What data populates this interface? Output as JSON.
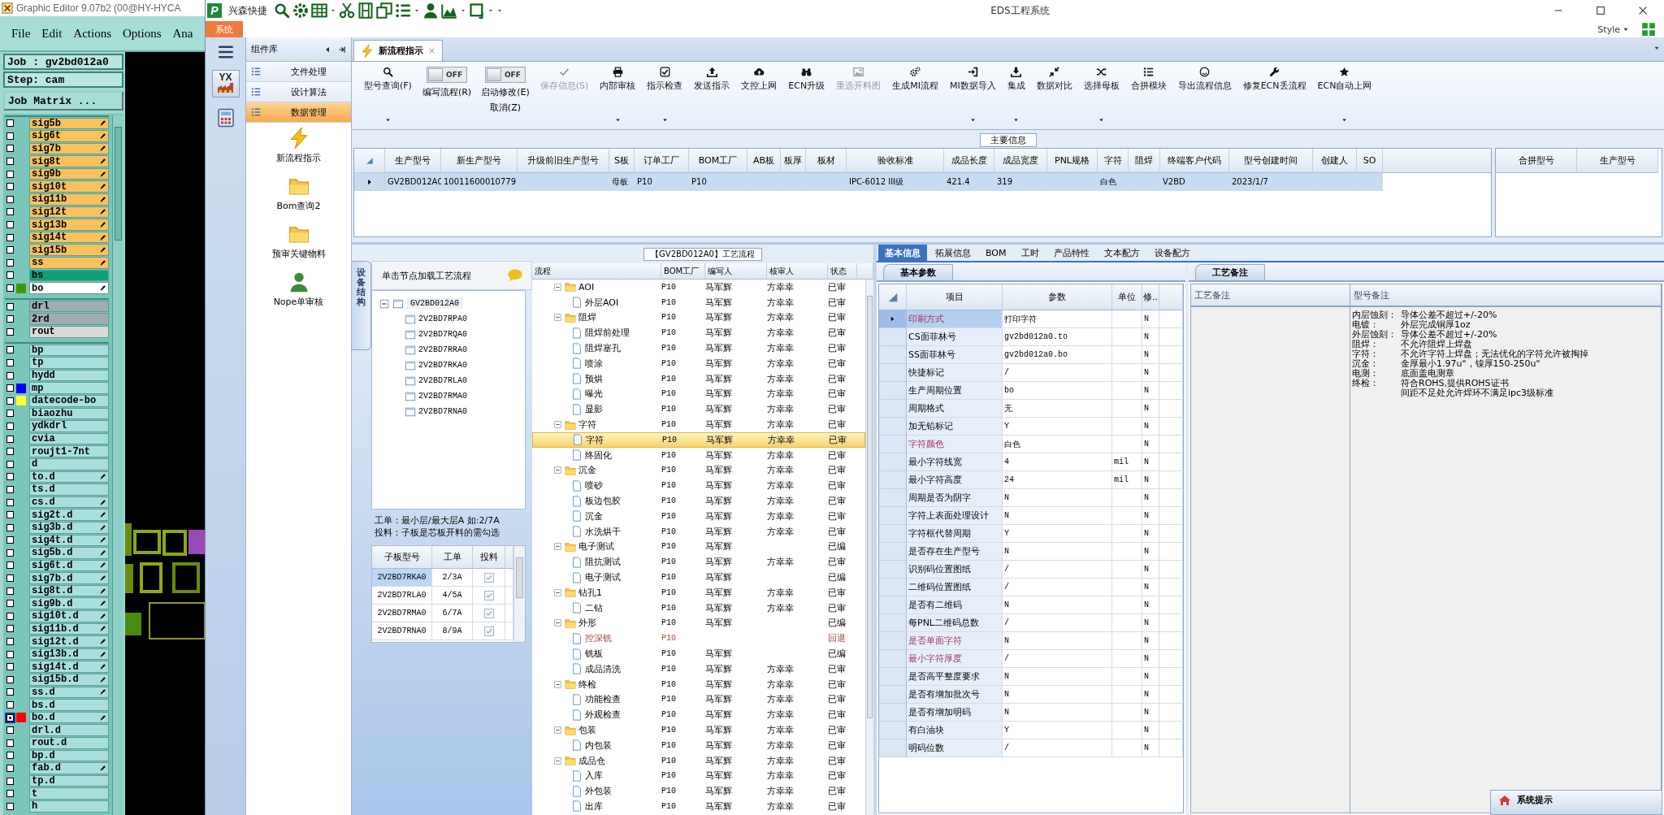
{
  "cam": {
    "title": "Graphic Editor 9.07b2 (00@HY-HYCA",
    "menu": [
      "File",
      "Edit",
      "Actions",
      "Options",
      "Ana"
    ],
    "job": "Job : gv2bd012a0",
    "step": "Step: cam",
    "matrix_button": "Job Matrix ...",
    "layer_groups": [
      [
        {
          "name": "sig5b",
          "color": "#f9c25c",
          "flag": true,
          "selected": false
        },
        {
          "name": "sig6t",
          "color": "#f9c25c",
          "flag": true,
          "selected": false
        },
        {
          "name": "sig7b",
          "color": "#f9c25c",
          "flag": true,
          "selected": false
        },
        {
          "name": "sig8t",
          "color": "#f9c25c",
          "flag": true,
          "selected": false
        },
        {
          "name": "sig9b",
          "color": "#f9c25c",
          "flag": true,
          "selected": false
        },
        {
          "name": "sig10t",
          "color": "#f9c25c",
          "flag": true,
          "selected": false
        },
        {
          "name": "sig11b",
          "color": "#f9c25c",
          "flag": true,
          "selected": false
        },
        {
          "name": "sig12t",
          "color": "#f9c25c",
          "flag": true,
          "selected": false
        },
        {
          "name": "sig13b",
          "color": "#f9c25c",
          "flag": true,
          "selected": false
        },
        {
          "name": "sig14t",
          "color": "#f9c25c",
          "flag": true,
          "selected": false
        },
        {
          "name": "sig15b",
          "color": "#f9c25c",
          "flag": true,
          "selected": false
        },
        {
          "name": "ss",
          "color": "#f9c25c",
          "flag": true,
          "selected": false
        },
        {
          "name": "bs",
          "color": "#12a078",
          "flag": false,
          "selected": false
        },
        {
          "name": "bo",
          "color": "#ffffff",
          "swatch": {
            "color": "#3c9a00"
          },
          "flag": true,
          "selected": false
        }
      ],
      [
        {
          "name": "drl",
          "color": "#a0adb3",
          "flag": false,
          "selected": false
        },
        {
          "name": "2rd",
          "color": "#a0adb3",
          "flag": false,
          "selected": false
        },
        {
          "name": "rout",
          "color": "#d9d9d9",
          "flag": false,
          "selected": false
        }
      ],
      [
        {
          "name": "bp",
          "color": "#a9dede",
          "flag": false,
          "selected": false
        },
        {
          "name": "tp",
          "color": "#a9dede",
          "flag": false,
          "selected": false
        },
        {
          "name": "hydd",
          "color": "#a9dede",
          "flag": false,
          "selected": false
        },
        {
          "name": "mp",
          "color": "#a9dede",
          "swatch": {
            "color": "#0000ff"
          },
          "flag": false,
          "selected": false
        },
        {
          "name": "datecode-bo",
          "color": "#a9dede",
          "swatch": {
            "color": "#ffff33"
          },
          "flag": false,
          "selected": false
        },
        {
          "name": "biaozhu",
          "color": "#a9dede",
          "flag": false,
          "selected": false
        },
        {
          "name": "ydkdrl",
          "color": "#a9dede",
          "flag": false,
          "selected": false
        },
        {
          "name": "cvia",
          "color": "#a9dede",
          "flag": false,
          "selected": false
        },
        {
          "name": "roujt1-7nt",
          "color": "#a9dede",
          "flag": false,
          "selected": false
        },
        {
          "name": "d",
          "color": "#a9dede",
          "flag": false,
          "selected": false
        },
        {
          "name": "to.d",
          "color": "#a9dede",
          "flag": true,
          "selected": false
        },
        {
          "name": "ts.d",
          "color": "#a9dede",
          "flag": false,
          "selected": false
        },
        {
          "name": "cs.d",
          "color": "#a9dede",
          "flag": true,
          "selected": false
        },
        {
          "name": "sig2t.d",
          "color": "#a9dede",
          "flag": true,
          "selected": false
        },
        {
          "name": "sig3b.d",
          "color": "#a9dede",
          "flag": true,
          "selected": false
        },
        {
          "name": "sig4t.d",
          "color": "#a9dede",
          "flag": true,
          "selected": false
        },
        {
          "name": "sig5b.d",
          "color": "#a9dede",
          "flag": true,
          "selected": false
        },
        {
          "name": "sig6t.d",
          "color": "#a9dede",
          "flag": true,
          "selected": false
        },
        {
          "name": "sig7b.d",
          "color": "#a9dede",
          "flag": true,
          "selected": false
        },
        {
          "name": "sig8t.d",
          "color": "#a9dede",
          "flag": true,
          "selected": false
        },
        {
          "name": "sig9b.d",
          "color": "#a9dede",
          "flag": true,
          "selected": false
        },
        {
          "name": "sig10t.d",
          "color": "#a9dede",
          "flag": true,
          "selected": false
        },
        {
          "name": "sig11b.d",
          "color": "#a9dede",
          "flag": true,
          "selected": false
        },
        {
          "name": "sig12t.d",
          "color": "#a9dede",
          "flag": true,
          "selected": false
        },
        {
          "name": "sig13b.d",
          "color": "#a9dede",
          "flag": true,
          "selected": false
        },
        {
          "name": "sig14t.d",
          "color": "#a9dede",
          "flag": true,
          "selected": false
        },
        {
          "name": "sig15b.d",
          "color": "#a9dede",
          "flag": true,
          "selected": false
        },
        {
          "name": "ss.d",
          "color": "#a9dede",
          "flag": true,
          "selected": false
        },
        {
          "name": "bs.d",
          "color": "#a9dede",
          "flag": false,
          "selected": false
        },
        {
          "name": "bo.d",
          "color": "#a9dede",
          "swatch": {
            "color": "#ff0000"
          },
          "flag": true,
          "selected": true
        },
        {
          "name": "drl.d",
          "color": "#a9dede",
          "flag": false,
          "selected": false
        },
        {
          "name": "rout.d",
          "color": "#a9dede",
          "flag": false,
          "selected": false
        },
        {
          "name": "bp.d",
          "color": "#a9dede",
          "flag": false,
          "selected": false
        },
        {
          "name": "fab.d",
          "color": "#a9dede",
          "flag": true,
          "selected": false
        },
        {
          "name": "tp.d",
          "color": "#a9dede",
          "flag": false,
          "selected": false
        },
        {
          "name": "t",
          "color": "#a9dede",
          "flag": false,
          "selected": false
        },
        {
          "name": "h",
          "color": "#a9dede",
          "flag": false,
          "selected": false
        }
      ]
    ]
  },
  "app": {
    "logo": "P",
    "brand": "兴森快捷",
    "title": "EDS工程系统",
    "system_tab": "系统",
    "style_menu": "Style",
    "strip_badge": "YX"
  },
  "nav": {
    "header": "组件库",
    "items": [
      {
        "label": "文件处理",
        "selected": false
      },
      {
        "label": "设计算法",
        "selected": false
      },
      {
        "label": "数据管理",
        "selected": true
      }
    ],
    "modules": [
      "新流程指示",
      "Bom查询2",
      "预审关键物料",
      "Nope单审核"
    ]
  },
  "doc_tab": "新流程指示",
  "ribbon": [
    {
      "kind": "button",
      "label": "型号查询(F)",
      "dropdown": true,
      "disabled": false
    },
    {
      "kind": "toggle",
      "label": "编写流程(R)",
      "state_text": "OFF",
      "on": false
    },
    {
      "kind": "toggle",
      "label": "启动修改(E)",
      "label2": "取消(Z)",
      "state_text": "OFF",
      "on": false
    },
    {
      "kind": "button",
      "label": "保存信息(S)",
      "dropdown": false,
      "disabled": true
    },
    {
      "kind": "button",
      "label": "内部审核",
      "dropdown": true,
      "disabled": false
    },
    {
      "kind": "button",
      "label": "指示检查",
      "dropdown": true,
      "disabled": false
    },
    {
      "kind": "button",
      "label": "发送指示",
      "dropdown": false,
      "disabled": false
    },
    {
      "kind": "button",
      "label": "文控上网",
      "dropdown": false,
      "disabled": false
    },
    {
      "kind": "button",
      "label": "ECN升级",
      "dropdown": false,
      "disabled": false
    },
    {
      "kind": "button",
      "label": "重选开料图",
      "dropdown": false,
      "disabled": true
    },
    {
      "kind": "button",
      "label": "生成MI流程",
      "dropdown": false,
      "disabled": false
    },
    {
      "kind": "button",
      "label": "MI数据导入",
      "dropdown": true,
      "disabled": false
    },
    {
      "kind": "button",
      "label": "集成",
      "dropdown": true,
      "disabled": false
    },
    {
      "kind": "button",
      "label": "数据对比",
      "dropdown": false,
      "disabled": false
    },
    {
      "kind": "button",
      "label": "选择母板",
      "dropdown": true,
      "disabled": false
    },
    {
      "kind": "button",
      "label": "合拼模块",
      "dropdown": false,
      "disabled": false
    },
    {
      "kind": "button",
      "label": "导出流程信息",
      "dropdown": false,
      "disabled": false
    },
    {
      "kind": "button",
      "label": "修复ECN丢流程",
      "dropdown": false,
      "disabled": false
    },
    {
      "kind": "button",
      "label": "ECN自动上网",
      "dropdown": true,
      "disabled": false
    }
  ],
  "main_info": {
    "title": "主要信息",
    "columns": [
      "生产型号",
      "新生产型号",
      "升级前旧生产型号",
      "S板",
      "订单工厂",
      "BOM工厂",
      "AB板",
      "板厚",
      "板材",
      "验收标准",
      "成品长度",
      "成品宽度",
      "PNL规格",
      "字符",
      "阻焊",
      "终端客户代码",
      "型号创建时间",
      "创建人",
      "SO"
    ],
    "rows": [
      {
        "selected": true,
        "cells": [
          "GV2BD012A0",
          "10011600010779",
          null,
          "母板",
          "P10",
          "P10",
          null,
          null,
          null,
          "IPC-6012 III级",
          "421.4",
          "319",
          null,
          "白色",
          null,
          "V2BD",
          "2023/1/7",
          null,
          null
        ]
      }
    ],
    "side_columns": [
      "合拼型号",
      "生产型号"
    ]
  },
  "board_panel": {
    "vertical_tab": "设备结构",
    "hint": "单击节点加载工艺流程",
    "tree": {
      "label": "GV2BD012A0",
      "expanded": true,
      "children": [
        "2V2BD7RPA0",
        "2V2BD7RQA0",
        "2V2BD7RRA0",
        "2V2BD7RKA0",
        "2V2BD7RLA0",
        "2V2BD7RMA0",
        "2V2BD7RNA0"
      ]
    },
    "notes": [
      "工单：最小层/最大层A 如:2/7A",
      "投料：子板是芯板开料的需勾选"
    ],
    "sub_table": {
      "columns": [
        "子板型号",
        "工单",
        "投料"
      ],
      "rows": [
        {
          "cells": [
            "2V2BD7RKA0",
            "2/3A"
          ],
          "checked": true,
          "selected": true
        },
        {
          "cells": [
            "2V2BD7RLA0",
            "4/5A"
          ],
          "checked": true,
          "selected": false
        },
        {
          "cells": [
            "2V2BD7RMA0",
            "6/7A"
          ],
          "checked": true,
          "selected": false
        },
        {
          "cells": [
            "2V2BD7RNA0",
            "8/9A"
          ],
          "checked": true,
          "selected": false
        }
      ]
    }
  },
  "process": {
    "title": "【GV2BD012A0】工艺流程",
    "columns": [
      "流程",
      "BOM工厂",
      "编写人",
      "核审人",
      "状态"
    ],
    "steps": [
      {
        "name": "AOI",
        "bom": "P10",
        "author": "马军辉",
        "reviewer": "方幸幸",
        "status": "已审",
        "returned": false,
        "selected": false,
        "expanded": true,
        "children": [
          {
            "name": "外层AOI",
            "bom": "P10",
            "author": "马军辉",
            "reviewer": "方幸幸",
            "status": "已审",
            "returned": false,
            "selected": false
          }
        ]
      },
      {
        "name": "阻焊",
        "bom": "P10",
        "author": "马军辉",
        "reviewer": "方幸幸",
        "status": "已审",
        "returned": false,
        "selected": false,
        "expanded": true,
        "children": [
          {
            "name": "阻焊前处理",
            "bom": "P10",
            "author": "马军辉",
            "reviewer": "方幸幸",
            "status": "已审",
            "returned": false,
            "selected": false
          },
          {
            "name": "阻焊塞孔",
            "bom": "P10",
            "author": "马军辉",
            "reviewer": "方幸幸",
            "status": "已审",
            "returned": false,
            "selected": false
          },
          {
            "name": "喷涂",
            "bom": "P10",
            "author": "马军辉",
            "reviewer": "方幸幸",
            "status": "已审",
            "returned": false,
            "selected": false
          },
          {
            "name": "预烘",
            "bom": "P10",
            "author": "马军辉",
            "reviewer": "方幸幸",
            "status": "已审",
            "returned": false,
            "selected": false
          },
          {
            "name": "曝光",
            "bom": "P10",
            "author": "马军辉",
            "reviewer": "方幸幸",
            "status": "已审",
            "returned": false,
            "selected": false
          },
          {
            "name": "显影",
            "bom": "P10",
            "author": "马军辉",
            "reviewer": "方幸幸",
            "status": "已审",
            "returned": false,
            "selected": false
          }
        ]
      },
      {
        "name": "字符",
        "bom": "P10",
        "author": "马军辉",
        "reviewer": "方幸幸",
        "status": "已审",
        "returned": false,
        "selected": false,
        "expanded": true,
        "children": [
          {
            "name": "字符",
            "bom": "P10",
            "author": "马军辉",
            "reviewer": "方幸幸",
            "status": "已审",
            "returned": false,
            "selected": true
          },
          {
            "name": "终固化",
            "bom": "P10",
            "author": "马军辉",
            "reviewer": "方幸幸",
            "status": "已审",
            "returned": false,
            "selected": false
          }
        ]
      },
      {
        "name": "沉金",
        "bom": "P10",
        "author": "马军辉",
        "reviewer": "方幸幸",
        "status": "已审",
        "returned": false,
        "selected": false,
        "expanded": true,
        "children": [
          {
            "name": "喷砂",
            "bom": "P10",
            "author": "马军辉",
            "reviewer": "方幸幸",
            "status": "已审",
            "returned": false,
            "selected": false
          },
          {
            "name": "板边包胶",
            "bom": "P10",
            "author": "马军辉",
            "reviewer": "方幸幸",
            "status": "已审",
            "returned": false,
            "selected": false
          },
          {
            "name": "沉金",
            "bom": "P10",
            "author": "马军辉",
            "reviewer": "方幸幸",
            "status": "已审",
            "returned": false,
            "selected": false
          },
          {
            "name": "水洗烘干",
            "bom": "P10",
            "author": "马军辉",
            "reviewer": "方幸幸",
            "status": "已审",
            "returned": false,
            "selected": false
          }
        ]
      },
      {
        "name": "电子测试",
        "bom": "P10",
        "author": "马军辉",
        "status": "已编",
        "returned": false,
        "selected": false,
        "expanded": true,
        "children": [
          {
            "name": "阻抗测试",
            "bom": "P10",
            "author": "马军辉",
            "reviewer": "方幸幸",
            "status": "已审",
            "returned": false,
            "selected": false
          },
          {
            "name": "电子测试",
            "bom": "P10",
            "author": "马军辉",
            "status": "已编",
            "returned": false,
            "selected": false
          }
        ]
      },
      {
        "name": "钻孔1",
        "bom": "P10",
        "author": "马军辉",
        "reviewer": "方幸幸",
        "status": "已审",
        "returned": false,
        "selected": false,
        "expanded": true,
        "children": [
          {
            "name": "二钻",
            "bom": "P10",
            "author": "马军辉",
            "reviewer": "方幸幸",
            "status": "已审",
            "returned": false,
            "selected": false
          }
        ]
      },
      {
        "name": "外形",
        "bom": "P10",
        "author": "马军辉",
        "status": "已编",
        "returned": false,
        "selected": false,
        "expanded": true,
        "children": [
          {
            "name": "控深铣",
            "bom": "P10",
            "status": "回退",
            "returned": true,
            "selected": false
          },
          {
            "name": "铣板",
            "bom": "P10",
            "author": "马军辉",
            "status": "已编",
            "returned": false,
            "selected": false
          },
          {
            "name": "成品清洗",
            "bom": "P10",
            "author": "马军辉",
            "reviewer": "方幸幸",
            "status": "已审",
            "returned": false,
            "selected": false
          }
        ]
      },
      {
        "name": "终检",
        "bom": "P10",
        "author": "马军辉",
        "reviewer": "方幸幸",
        "status": "已审",
        "returned": false,
        "selected": false,
        "expanded": true,
        "children": [
          {
            "name": "功能检查",
            "bom": "P10",
            "author": "马军辉",
            "reviewer": "方幸幸",
            "status": "已审",
            "returned": false,
            "selected": false
          },
          {
            "name": "外观检查",
            "bom": "P10",
            "author": "马军辉",
            "reviewer": "方幸幸",
            "status": "已审",
            "returned": false,
            "selected": false
          }
        ]
      },
      {
        "name": "包装",
        "bom": "P10",
        "author": "马军辉",
        "reviewer": "方幸幸",
        "status": "已审",
        "returned": false,
        "selected": false,
        "expanded": true,
        "children": [
          {
            "name": "内包装",
            "bom": "P10",
            "author": "马军辉",
            "reviewer": "方幸幸",
            "status": "已审",
            "returned": false,
            "selected": false
          }
        ]
      },
      {
        "name": "成品仓",
        "bom": "P10",
        "author": "马军辉",
        "reviewer": "方幸幸",
        "status": "已审",
        "returned": false,
        "selected": false,
        "expanded": true,
        "children": [
          {
            "name": "入库",
            "bom": "P10",
            "author": "马军辉",
            "reviewer": "方幸幸",
            "status": "已审",
            "returned": false,
            "selected": false
          },
          {
            "name": "外包装",
            "bom": "P10",
            "author": "马军辉",
            "reviewer": "方幸幸",
            "status": "已审",
            "returned": false,
            "selected": false
          },
          {
            "name": "出库",
            "bom": "P10",
            "author": "马军辉",
            "reviewer": "方幸幸",
            "status": "已审",
            "returned": false,
            "selected": false
          }
        ]
      }
    ]
  },
  "detail_tabs": [
    {
      "label": "基本信息",
      "selected": true
    },
    {
      "label": "拓展信息",
      "selected": false
    },
    {
      "label": "BOM",
      "selected": false
    },
    {
      "label": "工时",
      "selected": false
    },
    {
      "label": "产品特性",
      "selected": false
    },
    {
      "label": "文本配方",
      "selected": false
    },
    {
      "label": "设备配方",
      "selected": false
    }
  ],
  "params": {
    "tab": "基本参数",
    "columns": [
      "项目",
      "参数",
      "单位",
      "修.."
    ],
    "rows": [
      {
        "item": "印刷方式",
        "value": "打印字符",
        "flag": "N",
        "emphasized": true,
        "selected": true
      },
      {
        "item": "CS面菲林号",
        "value": "gv2bd012a0.to",
        "flag": "N",
        "emphasized": false,
        "selected": false
      },
      {
        "item": "SS面菲林号",
        "value": "gv2bd012a0.bo",
        "flag": "N",
        "emphasized": false,
        "selected": false
      },
      {
        "item": "快捷标记",
        "value": "/",
        "flag": "N",
        "emphasized": false,
        "selected": false
      },
      {
        "item": "生产周期位置",
        "value": "bo",
        "flag": "N",
        "emphasized": false,
        "selected": false
      },
      {
        "item": "周期格式",
        "value": "无",
        "flag": "N",
        "emphasized": false,
        "selected": false
      },
      {
        "item": "加无铅标记",
        "value": "Y",
        "flag": "N",
        "emphasized": false,
        "selected": false
      },
      {
        "item": "字符颜色",
        "value": "白色",
        "flag": "N",
        "emphasized": true,
        "selected": false
      },
      {
        "item": "最小字符线宽",
        "value": "4",
        "unit": "mil",
        "flag": "N",
        "emphasized": false,
        "selected": false
      },
      {
        "item": "最小字符高度",
        "value": "24",
        "unit": "mil",
        "flag": "N",
        "emphasized": false,
        "selected": false
      },
      {
        "item": "周期是否为阴字",
        "value": "N",
        "flag": "N",
        "emphasized": false,
        "selected": false
      },
      {
        "item": "字符上表面处理设计",
        "value": "N",
        "flag": "N",
        "emphasized": false,
        "selected": false
      },
      {
        "item": "字符框代替周期",
        "value": "Y",
        "flag": "N",
        "emphasized": false,
        "selected": false
      },
      {
        "item": "是否存在生产型号",
        "value": "N",
        "flag": "N",
        "emphasized": false,
        "selected": false
      },
      {
        "item": "识别码位置图纸",
        "value": "/",
        "flag": "N",
        "emphasized": false,
        "selected": false
      },
      {
        "item": "二维码位置图纸",
        "value": "/",
        "flag": "N",
        "emphasized": false,
        "selected": false
      },
      {
        "item": "是否有二维码",
        "value": "N",
        "flag": "N",
        "emphasized": false,
        "selected": false
      },
      {
        "item": "每PNL二维码总数",
        "value": "/",
        "flag": "N",
        "emphasized": false,
        "selected": false
      },
      {
        "item": "是否单面字符",
        "value": "N",
        "flag": "N",
        "emphasized": true,
        "selected": false
      },
      {
        "item": "最小字符厚度",
        "value": "/",
        "flag": "N",
        "emphasized": true,
        "selected": false
      },
      {
        "item": "是否高平整度要求",
        "value": "N",
        "flag": "N",
        "emphasized": false,
        "selected": false
      },
      {
        "item": "是否有增加批次号",
        "value": "N",
        "flag": "N",
        "emphasized": false,
        "selected": false
      },
      {
        "item": "是否有增加明码",
        "value": "N",
        "flag": "N",
        "emphasized": false,
        "selected": false
      },
      {
        "item": "有白油块",
        "value": "Y",
        "flag": "N",
        "emphasized": false,
        "selected": false
      },
      {
        "item": "明码位数",
        "value": "/",
        "flag": "N",
        "emphasized": false,
        "selected": false
      }
    ]
  },
  "remarks": {
    "tab": "工艺备注",
    "columns": [
      "工艺备注",
      "型号备注"
    ],
    "lines": [
      {
        "label": "内层蚀刻：",
        "text": "导体公差不超过+/-20%"
      },
      {
        "label": "电镀：",
        "text": "外层完成铜厚1oz"
      },
      {
        "label": "外层蚀刻：",
        "text": "导体公差不超过+/-20%"
      },
      {
        "label": "阻焊：",
        "text": "不允许阻焊上焊盘"
      },
      {
        "label": "字符：",
        "text": "不允许字符上焊盘；无法优化的字符允许被掏掉"
      },
      {
        "label": "沉金：",
        "text": "金厚最小1.97u\"，镍厚150-250u\""
      },
      {
        "label": "电测：",
        "text": "底面盖电测章"
      },
      {
        "label": "终检：",
        "text": "符合ROHS,提供ROHS证书"
      },
      {
        "text": "间距不足处允许焊环不满足ipc3级标准"
      }
    ]
  },
  "popup": {
    "title": "系统提示"
  }
}
